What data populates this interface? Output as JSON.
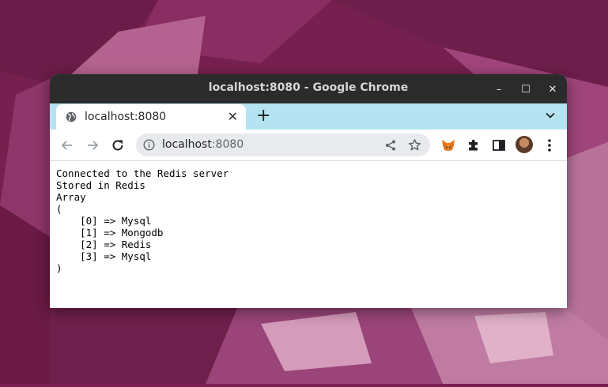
{
  "window": {
    "title": "localhost:8080 - Google Chrome",
    "controls": {
      "minimize": "–",
      "maximize": "☐",
      "close": "✕"
    }
  },
  "tabs": [
    {
      "title": "localhost:8080",
      "active": true,
      "close": "✕"
    }
  ],
  "tabstrip": {
    "new_tab": "+"
  },
  "toolbar": {
    "url_host": "localhost",
    "url_port": ":8080"
  },
  "page": {
    "lines": [
      "Connected to the Redis server",
      "Stored in Redis",
      "Array",
      "(",
      "    [0] => Mysql",
      "    [1] => Mongodb",
      "    [2] => Redis",
      "    [3] => Mysql",
      ")"
    ]
  },
  "colors": {
    "titlebar": "#2b2b2b",
    "tabstrip": "#b5e3f2",
    "omnibox": "#e8eaed",
    "desktop": "#7a1f52"
  }
}
